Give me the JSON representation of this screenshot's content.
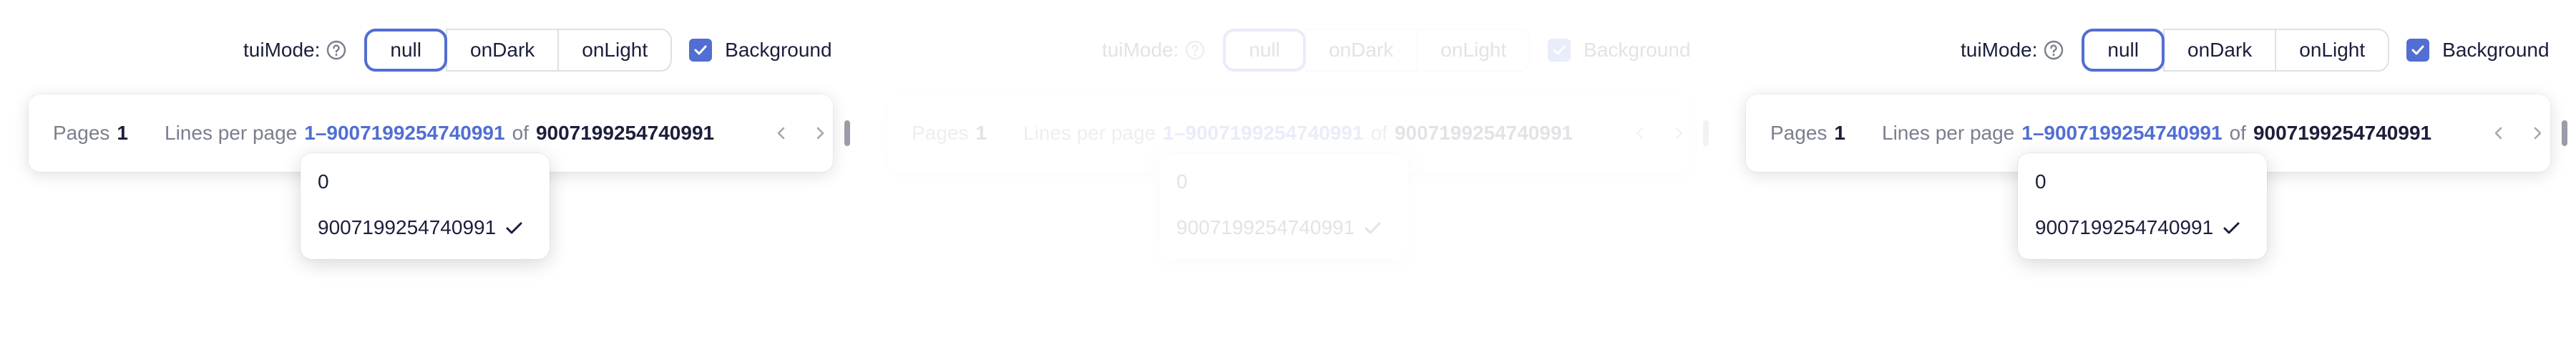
{
  "panels": [
    {
      "toolbar": {
        "mode_label": "tuiMode:",
        "help_icon": "question-circle-icon",
        "modes": [
          "null",
          "onDark",
          "onLight"
        ],
        "selected_mode": "null",
        "background_label": "Background",
        "background_checked": true
      },
      "pagination": {
        "pages_label": "Pages",
        "pages_value": "1",
        "lines_label": "Lines per page",
        "range": "1–9007199254740991",
        "of_label": "of",
        "total": "9007199254740991"
      },
      "dropdown": {
        "options": [
          "0",
          "9007199254740991"
        ],
        "selected": "9007199254740991"
      }
    },
    {
      "toolbar": {
        "mode_label": "tuiMode:",
        "help_icon": "question-circle-icon",
        "modes": [
          "null",
          "onDark",
          "onLight"
        ],
        "selected_mode": "null",
        "background_label": "Background",
        "background_checked": true
      },
      "pagination": {
        "pages_label": "Pages",
        "pages_value": "1",
        "lines_label": "Lines per page",
        "range": "1–9007199254740991",
        "of_label": "of",
        "total": "9007199254740991"
      },
      "dropdown": {
        "options": [
          "0",
          "9007199254740991"
        ],
        "selected": "9007199254740991"
      }
    },
    {
      "toolbar": {
        "mode_label": "tuiMode:",
        "help_icon": "question-circle-icon",
        "modes": [
          "null",
          "onDark",
          "onLight"
        ],
        "selected_mode": "null",
        "background_label": "Background",
        "background_checked": true
      },
      "pagination": {
        "pages_label": "Pages",
        "pages_value": "1",
        "lines_label": "Lines per page",
        "range": "1–9007199254740991",
        "of_label": "of",
        "total": "9007199254740991"
      },
      "dropdown": {
        "options": [
          "0",
          "9007199254740991"
        ],
        "selected": "9007199254740991"
      }
    }
  ],
  "colors": {
    "accent": "#526ed3",
    "text": "#1b1f3b",
    "muted": "#7b7e8e",
    "border": "#dfe0e6"
  }
}
